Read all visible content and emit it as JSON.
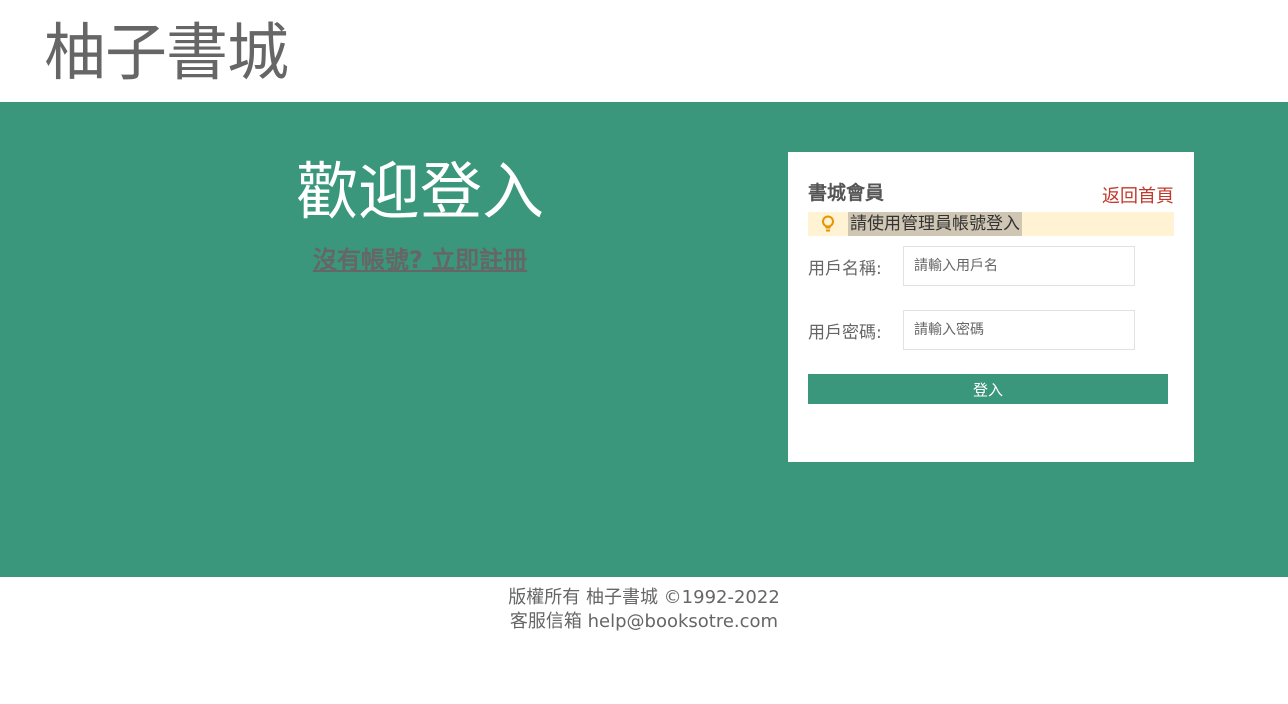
{
  "header": {
    "logo": "柚子書城"
  },
  "welcome": {
    "title": "歡迎登入",
    "register_link": "沒有帳號? 立即註冊"
  },
  "login_box": {
    "title": "書城會員",
    "home_link": "返回首頁",
    "tip_icon": "lightbulb-icon",
    "tip": "請使用管理員帳號登入",
    "username_label": "用戶名稱:",
    "username_placeholder": "請輸入用戶名",
    "password_label": "用戶密碼:",
    "password_placeholder": "請輸入密碼",
    "submit_label": "登入"
  },
  "footer": {
    "copyright": "版權所有 柚子書城 ©1992-2022",
    "contact": "客服信箱 help@booksotre.com"
  },
  "colors": {
    "brand_green": "#3a977c",
    "link_red": "#c0392b",
    "tip_background": "#fff3d4",
    "tip_icon": "#e69500"
  }
}
